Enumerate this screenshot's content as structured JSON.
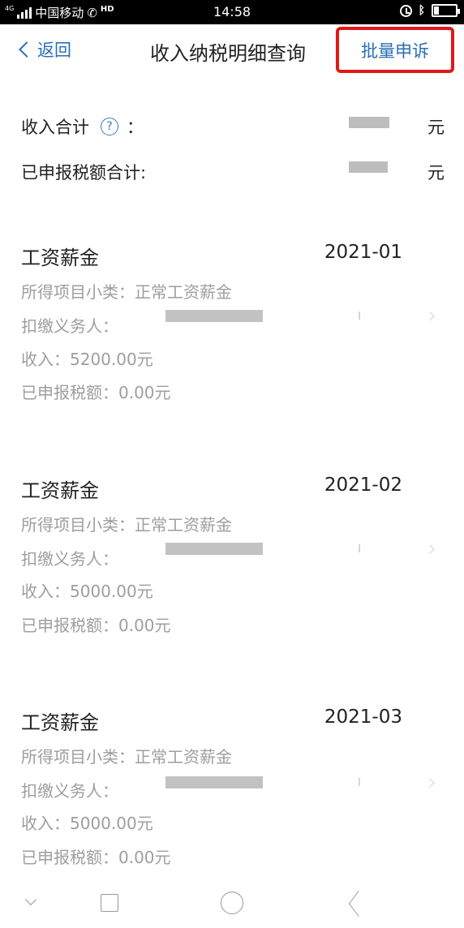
{
  "status_bar": {
    "network": "4G",
    "carrier": "中国移动",
    "hd": "HD",
    "time": "14:58"
  },
  "header": {
    "back_label": "返回",
    "title": "收入纳税明细查询",
    "batch_label": "批量申诉"
  },
  "summary": {
    "income_label": "收入合计",
    "income_colon": "：",
    "income_unit": "元",
    "tax_label": "已申报税额合计:",
    "tax_unit": "元"
  },
  "records": [
    {
      "title": "工资薪金",
      "date": "2021-01",
      "subcategory": "所得项目小类：正常工资薪金",
      "withholder_label": "扣缴义务人：",
      "income": "收入：5200.00元",
      "tax": "已申报税额：0.00元"
    },
    {
      "title": "工资薪金",
      "date": "2021-02",
      "subcategory": "所得项目小类：正常工资薪金",
      "withholder_label": "扣缴义务人：",
      "income": "收入：5000.00元",
      "tax": "已申报税额：0.00元"
    },
    {
      "title": "工资薪金",
      "date": "2021-03",
      "subcategory": "所得项目小类：正常工资薪金",
      "withholder_label": "扣缴义务人：",
      "income": "收入：5000.00元",
      "tax": "已申报税额：0.00元"
    }
  ],
  "colors": {
    "accent": "#2a6fb5",
    "highlight_border": "#e01818",
    "secondary_text": "#9e9e9e"
  }
}
